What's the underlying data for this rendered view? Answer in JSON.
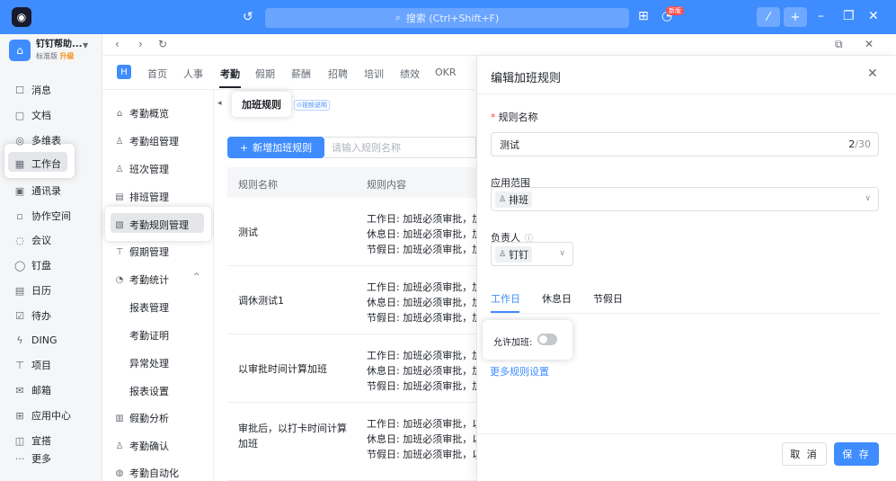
{
  "topbar": {
    "search_placeholder": "搜索 (Ctrl+Shift+F)",
    "new_badge": "新版",
    "accent": "#3f8cff"
  },
  "org": {
    "name": "钉钉帮助...",
    "edition": "标准版",
    "upgrade": "升级"
  },
  "leftnav": {
    "items": [
      {
        "icon": "message-icon",
        "glyph": "☐",
        "label": "消息"
      },
      {
        "icon": "doc-icon",
        "glyph": "▢",
        "label": "文档"
      },
      {
        "icon": "table-icon",
        "glyph": "◎",
        "label": "多维表"
      },
      {
        "icon": "workbench-icon",
        "glyph": "▦",
        "label": "工作台"
      },
      {
        "icon": "contacts-icon",
        "glyph": "▣",
        "label": "通讯录"
      },
      {
        "icon": "space-icon",
        "glyph": "▫",
        "label": "协作空间"
      },
      {
        "icon": "meeting-icon",
        "glyph": "◌",
        "label": "会议"
      },
      {
        "icon": "drive-icon",
        "glyph": "◯",
        "label": "钉盘"
      },
      {
        "icon": "calendar-icon",
        "glyph": "▤",
        "label": "日历"
      },
      {
        "icon": "todo-icon",
        "glyph": "☑",
        "label": "待办"
      },
      {
        "icon": "ding-icon",
        "glyph": "ϟ",
        "label": "DING"
      },
      {
        "icon": "project-icon",
        "glyph": "⊤",
        "label": "项目"
      },
      {
        "icon": "mail-icon",
        "glyph": "✉",
        "label": "邮箱"
      },
      {
        "icon": "app-center-icon",
        "glyph": "⊞",
        "label": "应用中心"
      },
      {
        "icon": "official-icon",
        "glyph": "◫",
        "label": "宜搭"
      },
      {
        "icon": "more-icon",
        "glyph": "···",
        "label": "更多"
      }
    ]
  },
  "modtabs": [
    "首页",
    "人事",
    "考勤",
    "假期",
    "薪酬",
    "招聘",
    "培训",
    "绩效",
    "OKR"
  ],
  "menu": {
    "items": [
      {
        "icon": "home-icon",
        "glyph": "⌂",
        "label": "考勤概览"
      },
      {
        "icon": "group-icon",
        "glyph": "♙",
        "label": "考勤组管理"
      },
      {
        "icon": "shift-icon",
        "glyph": "♙",
        "label": "班次管理"
      },
      {
        "icon": "schedule-icon",
        "glyph": "▤",
        "label": "排班管理"
      },
      {
        "icon": "rules-icon",
        "glyph": "▧",
        "label": "考勤规则管理"
      },
      {
        "icon": "leave-icon",
        "glyph": "⊤",
        "label": "假期管理"
      },
      {
        "icon": "stats-icon",
        "glyph": "◔",
        "label": "考勤统计"
      }
    ],
    "stats_children": [
      "报表管理",
      "考勤证明",
      "异常处理",
      "报表设置"
    ],
    "tail": [
      {
        "icon": "analysis-icon",
        "glyph": "▥",
        "label": "假勤分析"
      },
      {
        "icon": "confirm-icon",
        "glyph": "♙",
        "label": "考勤确认"
      },
      {
        "icon": "auto-icon",
        "glyph": "◍",
        "label": "考勤自动化"
      }
    ]
  },
  "content": {
    "page_title": "加班规则",
    "video_link": "视频说明",
    "add_button": "新增加班规则",
    "search_placeholder": "请输入规则名称",
    "columns": [
      "规则名称",
      "规则内容"
    ],
    "rows": [
      {
        "name": "测试",
        "lines": [
          "工作日: 加班必须审批，加",
          "休息日: 加班必须审批，加",
          "节假日: 加班必须审批，加"
        ]
      },
      {
        "name": "调休测试1",
        "lines": [
          "工作日: 加班必须审批，加",
          "休息日: 加班必须审批，加",
          "节假日: 加班必须审批，加"
        ]
      },
      {
        "name": "以审批时间计算加班",
        "lines": [
          "工作日: 加班必须审批，加",
          "休息日: 加班必须审批，加",
          "节假日: 加班必须审批，加"
        ]
      },
      {
        "name": "审批后，以打卡时间计算加班",
        "lines": [
          "工作日: 加班必须审批，以",
          "休息日: 加班必须审批，以",
          "节假日: 加班必须审批，以"
        ]
      }
    ]
  },
  "drawer": {
    "title": "编辑加班规则",
    "name_label": "规则名称",
    "name_value": "测试",
    "name_count": "2",
    "name_max": "/30",
    "scope_label": "应用范围",
    "scope_tag": "排班",
    "owner_label": "负责人",
    "owner_tag": "钉钉",
    "tabs": [
      "工作日",
      "休息日",
      "节假日"
    ],
    "allow_overtime_label": "允许加班:",
    "allow_overtime_on": false,
    "more_settings": "更多规则设置",
    "cancel": "取 消",
    "save": "保 存"
  }
}
